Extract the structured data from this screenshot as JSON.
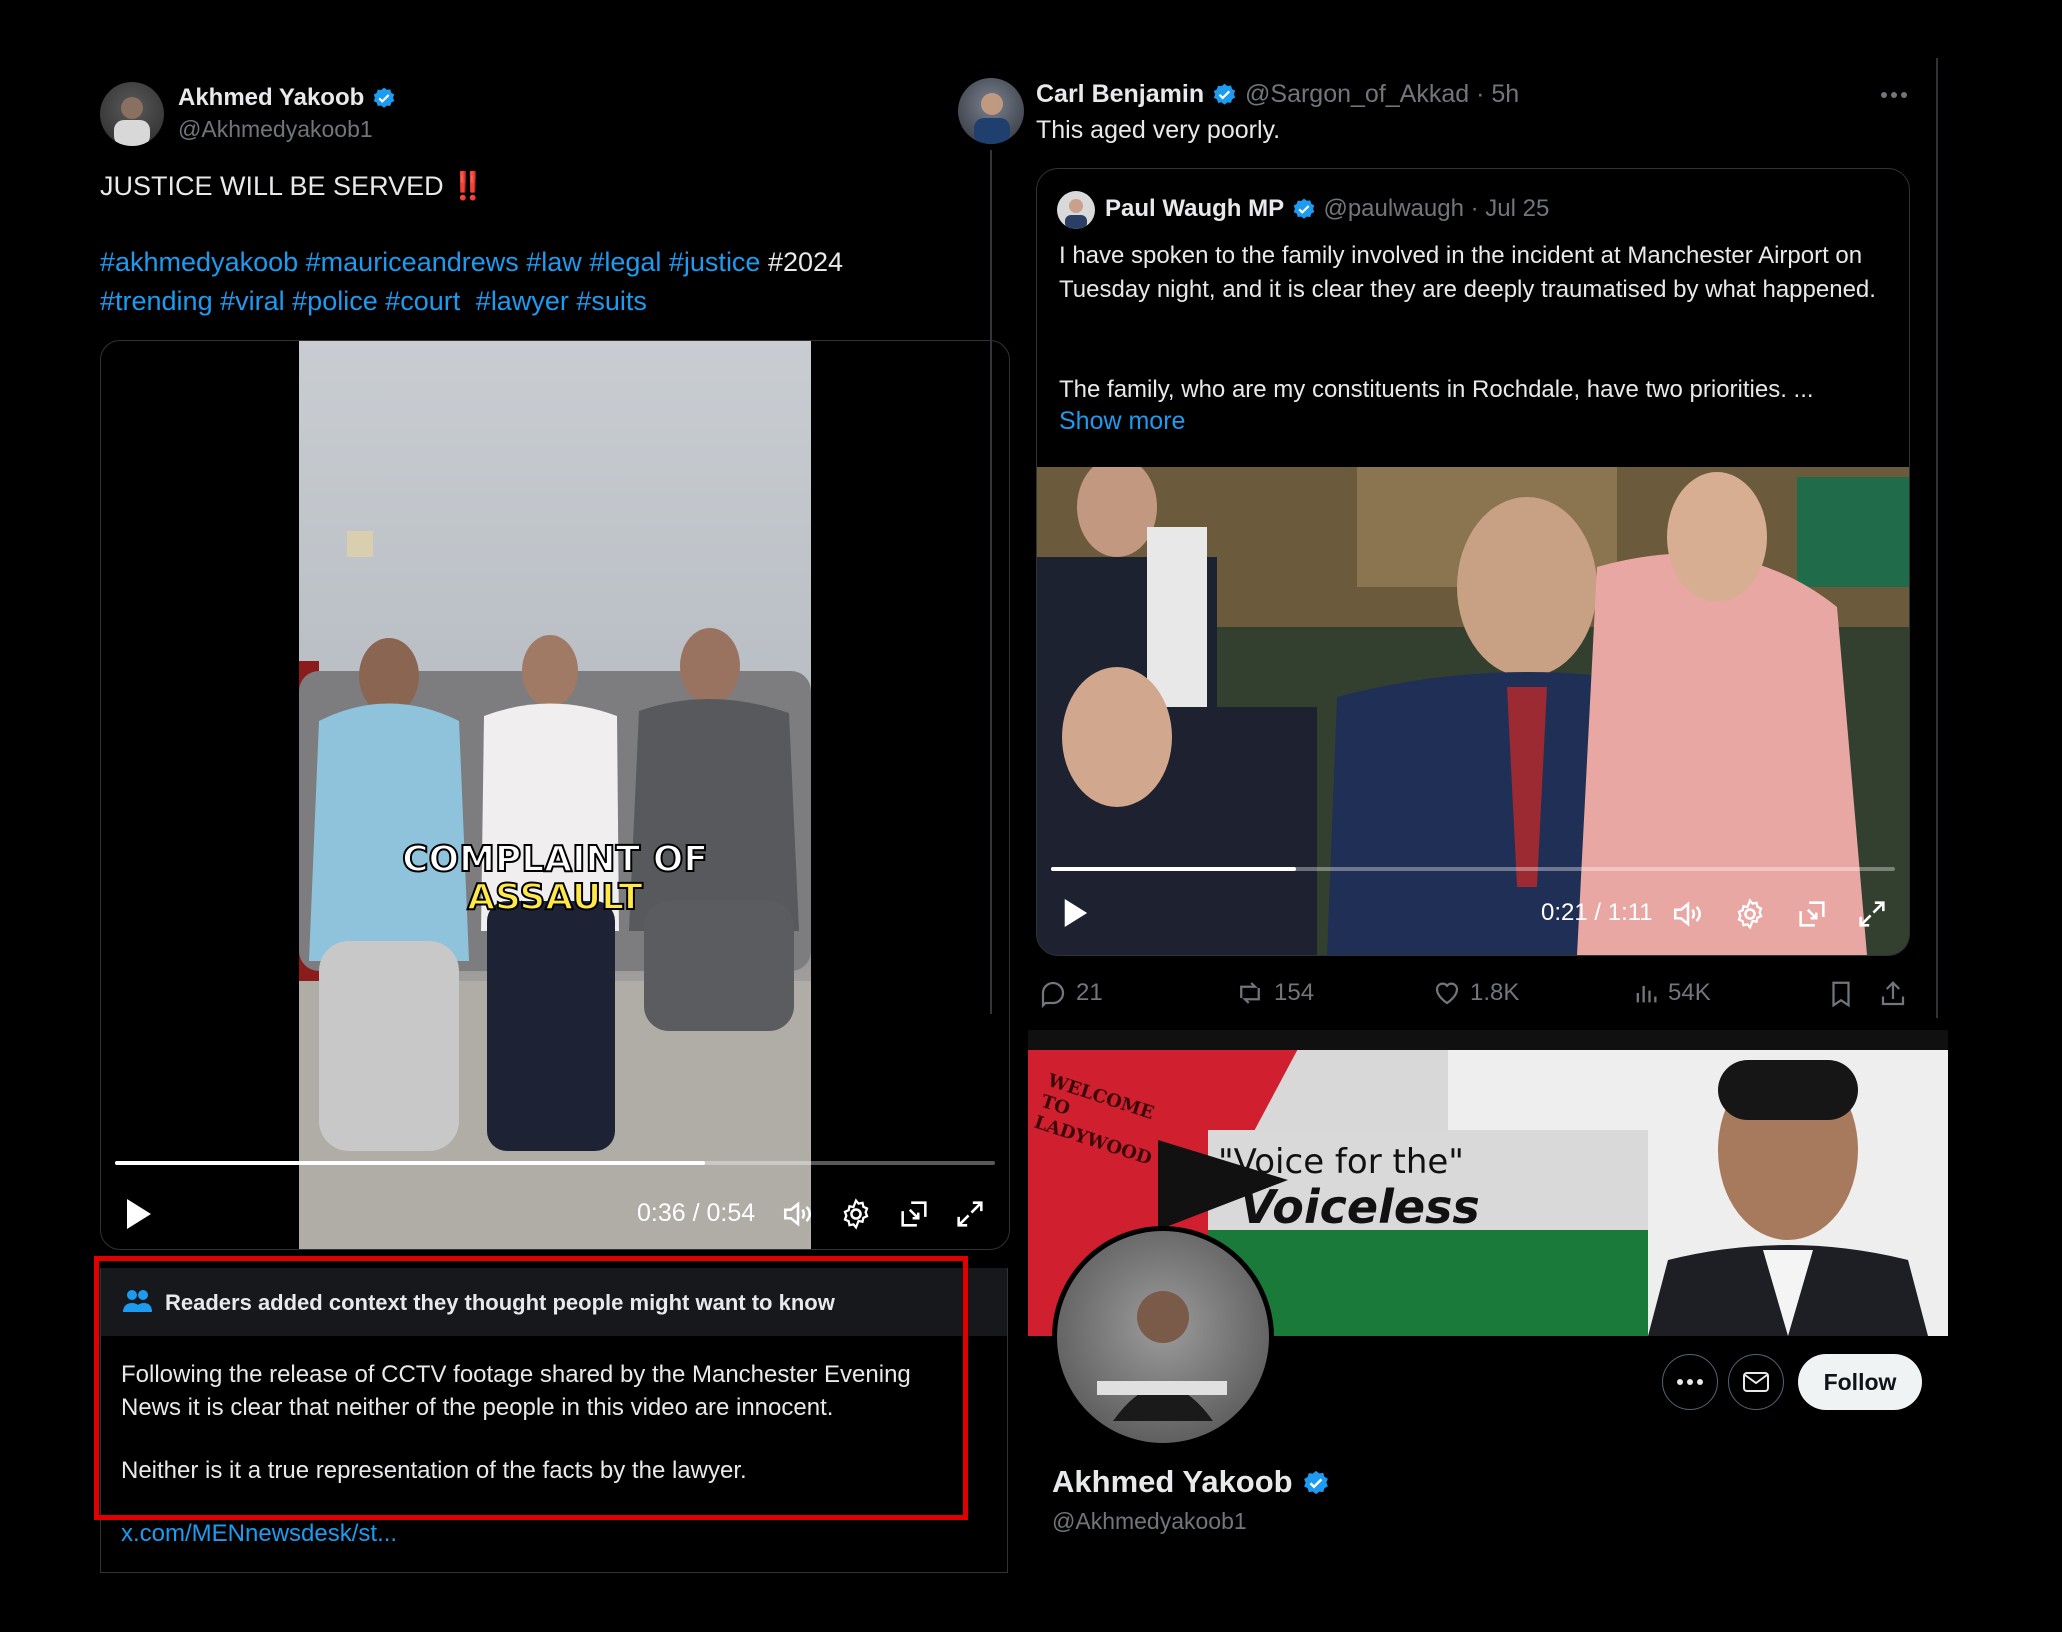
{
  "colors": {
    "accent": "#1d9bf0",
    "background": "#000000",
    "highlight_box": "#e00000"
  },
  "left_tweet": {
    "author_name": "Akhmed Yakoob",
    "author_handle": "@Akhmedyakoob1",
    "text": "JUSTICE WILL BE SERVED",
    "emoji": "‼️",
    "hashtags_line1": [
      "#akhmedyakoob",
      "#mauriceandrews",
      "#law",
      "#legal",
      "#justice"
    ],
    "plain_tag": "#2024",
    "hashtags_line2": [
      "#trending",
      "#viral",
      "#police",
      "#court",
      "#lawyer",
      "#suits"
    ],
    "video": {
      "caption_line1": "COMPLAINT OF",
      "caption_line2": "ASSAULT",
      "time": "0:36 / 0:54",
      "progress": 0.67
    },
    "community_note": {
      "header": "Readers added context they thought people might want to know",
      "para1": "Following the release of CCTV footage shared by the Manchester Evening News it is clear that neither of the people in this video are innocent.",
      "para2": "Neither is it a true representation of the facts by the lawyer.",
      "link": "x.com/MENnewsdesk/st..."
    }
  },
  "right_tweet": {
    "author_name": "Carl Benjamin",
    "author_handle": "@Sargon_of_Akkad",
    "time": "· 5h",
    "text": "This aged very poorly.",
    "quoted": {
      "author_name": "Paul Waugh MP",
      "author_handle": "@paulwaugh",
      "time": "· Jul 25",
      "para1": "I have spoken to the family involved in the incident at Manchester Airport on Tuesday night, and it is clear they are deeply traumatised by what happened.",
      "para2": "The family, who are my constituents in Rochdale, have two priorities. ...",
      "show_more": "Show more",
      "video_time": "0:21 / 1:11",
      "progress": 0.29
    },
    "actions": {
      "replies": "21",
      "reposts": "154",
      "likes": "1.8K",
      "views": "54K"
    }
  },
  "profile": {
    "banner_sign": "WELCOME TO LADYWOOD",
    "banner_line1": "\"Voice for the\"",
    "banner_line2": "Voiceless",
    "follow_label": "Follow",
    "name": "Akhmed Yakoob",
    "handle": "@Akhmedyakoob1"
  }
}
